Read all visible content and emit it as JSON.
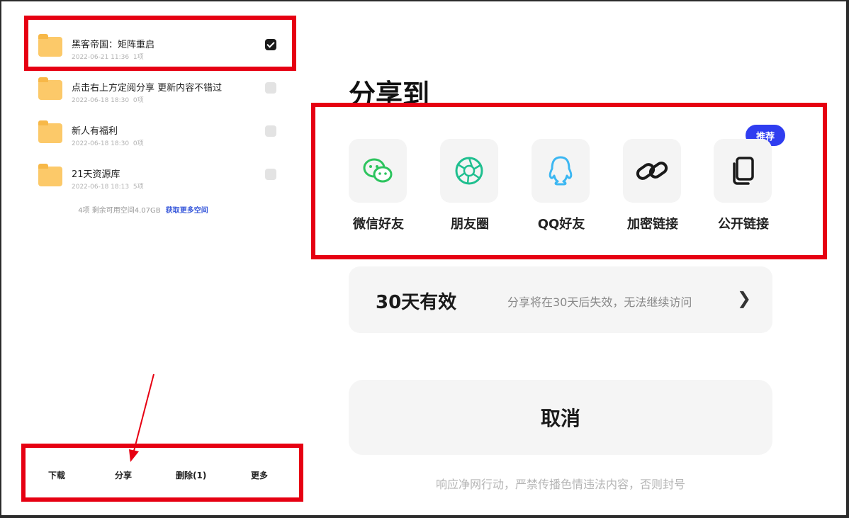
{
  "files": [
    {
      "name": "黑客帝国：矩阵重启",
      "date": "2022-06-21 11:36",
      "count": "1项",
      "checked": true
    },
    {
      "name": "点击右上方定阅分享 更新内容不错过",
      "date": "2022-06-18 18:30",
      "count": "0项",
      "checked": false
    },
    {
      "name": "新人有福利",
      "date": "2022-06-18 18:30",
      "count": "0项",
      "checked": false
    },
    {
      "name": "21天资源库",
      "date": "2022-06-18 18:13",
      "count": "5项",
      "checked": false
    }
  ],
  "storage": {
    "text": "4项 剩余可用空间4.07GB",
    "link": "获取更多空间"
  },
  "bottom_bar": {
    "download": "下载",
    "share": "分享",
    "delete": "删除(1)",
    "more": "更多"
  },
  "share_panel": {
    "title": "分享到",
    "badge": "推荐",
    "options": [
      {
        "label": "微信好友",
        "icon": "wechat-icon",
        "color": "#2dc45e"
      },
      {
        "label": "朋友圈",
        "icon": "moments-icon",
        "color": "#1fbf8f"
      },
      {
        "label": "QQ好友",
        "icon": "qq-icon",
        "color": "#3cb7f2"
      },
      {
        "label": "加密链接",
        "icon": "link-icon",
        "color": "#1a1a1a"
      },
      {
        "label": "公开链接",
        "icon": "copy-icon",
        "color": "#1a1a1a"
      }
    ],
    "validity": {
      "title": "30天有效",
      "desc": "分享将在30天后失效，无法继续访问",
      "chevron": "❯"
    },
    "cancel": "取消",
    "notice": "响应净网行动，严禁传播色情违法内容，否则封号"
  },
  "colors": {
    "highlight": "#e60012",
    "badge": "#2f3df0",
    "folder": "#fcc969"
  }
}
